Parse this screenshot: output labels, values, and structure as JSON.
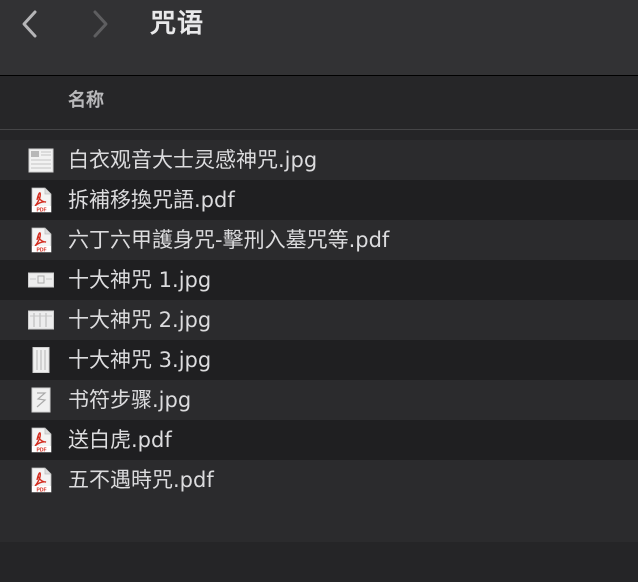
{
  "window": {
    "title": "咒语",
    "back_icon": "chevron-left-icon",
    "forward_icon": "chevron-right-icon"
  },
  "columns": {
    "name_header": "名称"
  },
  "files": [
    {
      "name": "白衣观音大士灵感神咒.jpg",
      "type": "jpg",
      "icon": "image-thumbnail-icon"
    },
    {
      "name": "拆補移換咒語.pdf",
      "type": "pdf",
      "icon": "pdf-icon"
    },
    {
      "name": "六丁六甲護身咒-擊刑入墓咒等.pdf",
      "type": "pdf",
      "icon": "pdf-icon"
    },
    {
      "name": "十大神咒 1.jpg",
      "type": "jpg",
      "icon": "image-thumbnail-icon"
    },
    {
      "name": "十大神咒 2.jpg",
      "type": "jpg",
      "icon": "image-thumbnail-icon"
    },
    {
      "name": "十大神咒 3.jpg",
      "type": "jpg",
      "icon": "image-thumbnail-icon"
    },
    {
      "name": "书符步骤.jpg",
      "type": "jpg",
      "icon": "image-thumbnail-icon"
    },
    {
      "name": "送白虎.pdf",
      "type": "pdf",
      "icon": "pdf-icon"
    },
    {
      "name": "五不遇時咒.pdf",
      "type": "pdf",
      "icon": "pdf-icon"
    }
  ],
  "colors": {
    "pdf_red": "#d42d20",
    "text": "#dcdcde",
    "toolbar_bg": "#323234"
  },
  "pdf_badge": "PDF"
}
